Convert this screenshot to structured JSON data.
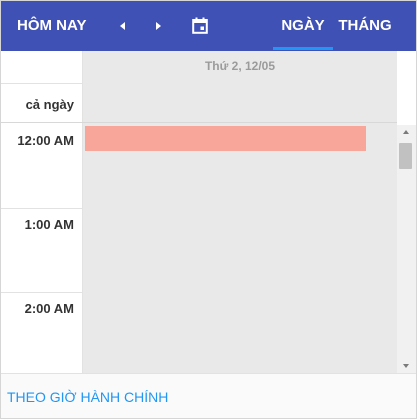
{
  "toolbar": {
    "today_label": "HÔM NAY",
    "prev_icon": "chevron-left-icon",
    "next_icon": "chevron-right-icon",
    "calendar_icon": "calendar-icon",
    "views": [
      {
        "label": "NGÀY",
        "active": true
      },
      {
        "label": "THÁNG",
        "active": false
      }
    ],
    "background": "#3f51b5",
    "active_indicator": "#2196f3"
  },
  "day_header": "Thứ 2, 12/05",
  "all_day_label": "cả ngày",
  "time_slots": [
    "12:00 AM",
    "1:00 AM",
    "2:00 AM"
  ],
  "events": [
    {
      "start": "12:00 AM",
      "color": "#f8a59a"
    }
  ],
  "footer": {
    "link_label": "THEO GIỜ HÀNH CHÍNH",
    "link_color": "#2196f3"
  }
}
